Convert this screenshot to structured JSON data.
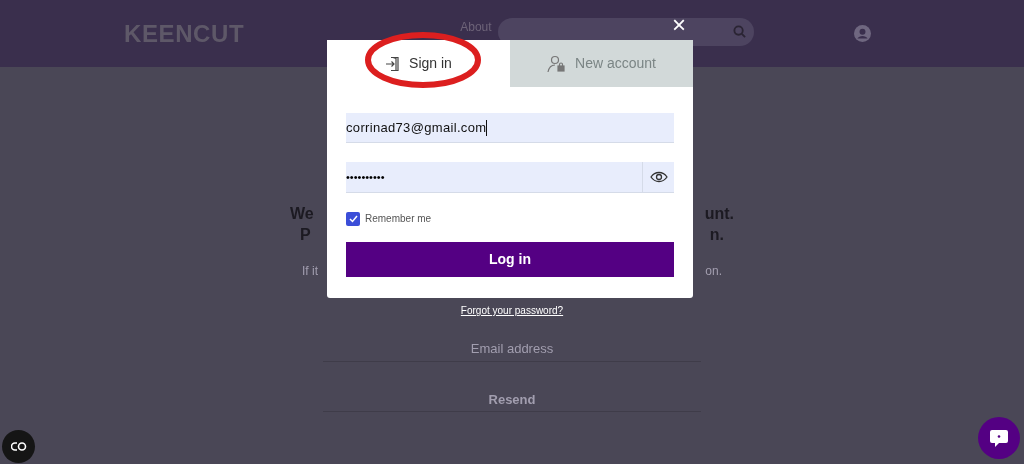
{
  "header": {
    "logo": "KEENCUT",
    "nav": [
      "About"
    ]
  },
  "background": {
    "fragments": [
      {
        "left": "We",
        "right": "unt.",
        "kind": "heading"
      },
      {
        "left": "P",
        "right": "n.",
        "kind": "heading"
      },
      {
        "left": "If it",
        "right": "on.",
        "kind": "note"
      }
    ],
    "email_field": {
      "placeholder": "Email address"
    },
    "resend": "Resend"
  },
  "modal": {
    "close": "×",
    "tabs": [
      {
        "label": "Sign in",
        "selected": true,
        "kind": "signin",
        "highlighted": true
      },
      {
        "label": "New account",
        "selected": false,
        "kind": "register",
        "highlighted": false
      }
    ],
    "email": {
      "value": "corrinad73@gmail.com"
    },
    "password": {
      "value": "••••••••••"
    },
    "remember": {
      "label": "Remember me",
      "checked": true
    },
    "submit": "Log in"
  },
  "forgot_link": "Forgot your password?"
}
